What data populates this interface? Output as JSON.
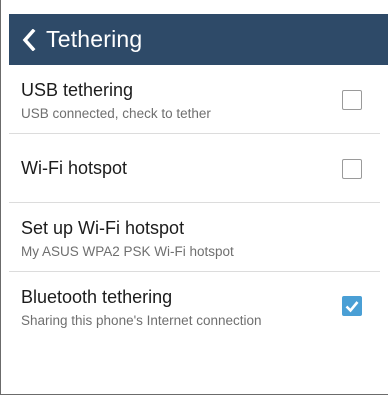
{
  "header": {
    "title": "Tethering",
    "back_icon": "chevron-left-icon",
    "background": "#2e4a68"
  },
  "settings": [
    {
      "title": "USB tethering",
      "subtitle": "USB connected, check to tether",
      "checkbox": true,
      "checked": false
    },
    {
      "title": "Wi-Fi hotspot",
      "subtitle": "",
      "checkbox": true,
      "checked": false
    },
    {
      "title": "Set up Wi-Fi hotspot",
      "subtitle": "My ASUS WPA2 PSK Wi-Fi hotspot",
      "checkbox": false,
      "checked": false
    },
    {
      "title": "Bluetooth tethering",
      "subtitle": "Sharing this phone's Internet connection",
      "checkbox": true,
      "checked": true
    }
  ],
  "colors": {
    "accent": "#4a9fd5",
    "title_text": "#1c1c1c",
    "subtitle_text": "#6f6f6f"
  }
}
